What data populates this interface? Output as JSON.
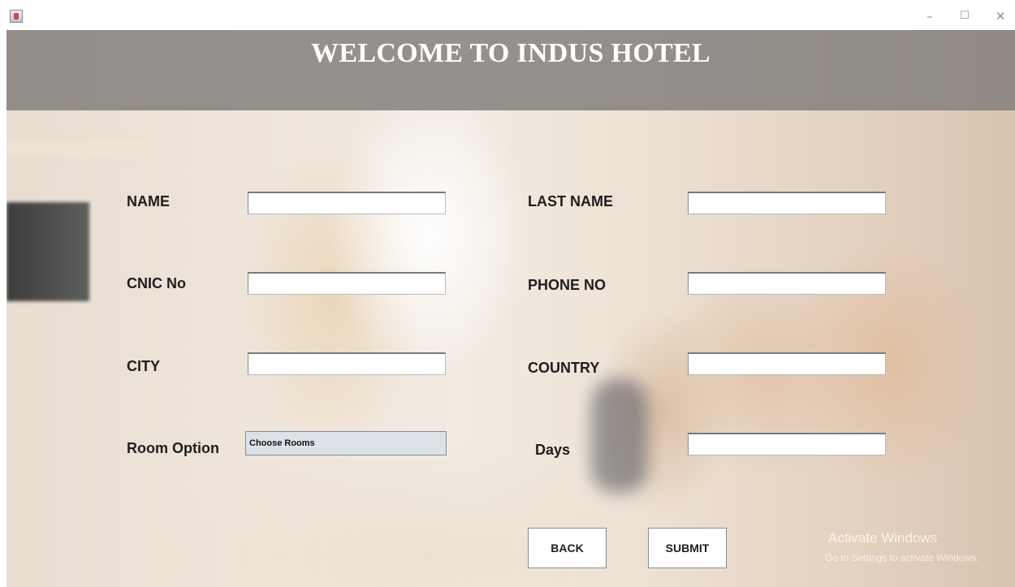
{
  "window": {
    "icon": "java-icon",
    "controls": [
      "minimize",
      "maximize",
      "close"
    ]
  },
  "header": {
    "title": "WELCOME TO INDUS HOTEL"
  },
  "form": {
    "name_label": "NAME",
    "name_value": "",
    "last_name_label": "LAST NAME",
    "last_name_value": "",
    "cnic_label": "CNIC No",
    "cnic_value": "",
    "phone_label": "PHONE NO",
    "phone_value": "",
    "city_label": "CITY",
    "city_value": "",
    "country_label": "COUNTRY",
    "country_value": "",
    "room_option_label": "Room Option",
    "room_option_selected": "Choose Rooms",
    "days_label": "Days",
    "days_value": ""
  },
  "actions": {
    "back_label": "BACK",
    "submit_label": "SUBMIT"
  },
  "watermark": {
    "title": "Activate Windows",
    "subtitle": "Go to Settings to activate Windows."
  }
}
